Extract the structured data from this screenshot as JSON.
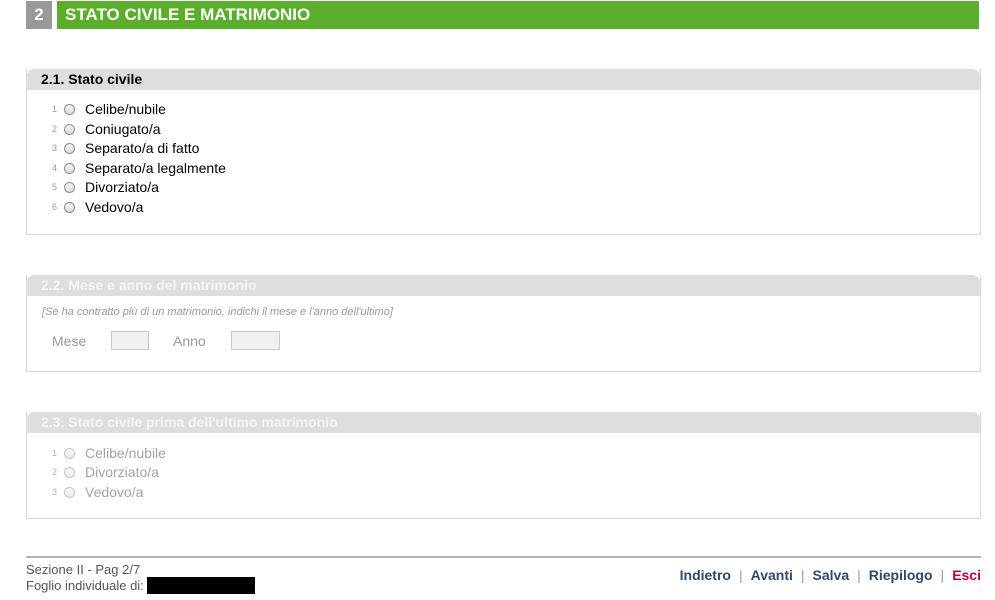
{
  "header": {
    "number": "2",
    "title": "STATO CIVILE E MATRIMONIO"
  },
  "section1": {
    "title": "2.1. Stato civile",
    "options": [
      {
        "idx": "1",
        "label": "Celibe/nubile"
      },
      {
        "idx": "2",
        "label": "Coniugato/a"
      },
      {
        "idx": "3",
        "label": "Separato/a di fatto"
      },
      {
        "idx": "4",
        "label": "Separato/a legalmente"
      },
      {
        "idx": "5",
        "label": "Divorziato/a"
      },
      {
        "idx": "6",
        "label": "Vedovo/a"
      }
    ]
  },
  "section2": {
    "title": "2.2. Mese e anno del matrimonio",
    "hint": "[Se ha contratto più di un matrimonio, indichi il mese e l'anno dell'ultimo]",
    "month_label": "Mese",
    "year_label": "Anno",
    "month_value": "",
    "year_value": ""
  },
  "section3": {
    "title": "2.3. Stato civile prima dell'ultimo matrimonio",
    "options": [
      {
        "idx": "1",
        "label": "Celibe/nubile"
      },
      {
        "idx": "2",
        "label": "Divorziato/a"
      },
      {
        "idx": "3",
        "label": "Vedovo/a"
      }
    ]
  },
  "footer": {
    "page_info": "Sezione II - Pag 2/7",
    "sheet_label": "Foglio individuale di:",
    "nav": {
      "back": "Indietro",
      "next": "Avanti",
      "save": "Salva",
      "summary": "Riepilogo",
      "exit": "Esci"
    }
  },
  "colors": {
    "header_green": "#5aae2c",
    "header_number_bg": "#999999",
    "exit_link": "#b8004a",
    "nav_link": "#2e4a6b"
  }
}
